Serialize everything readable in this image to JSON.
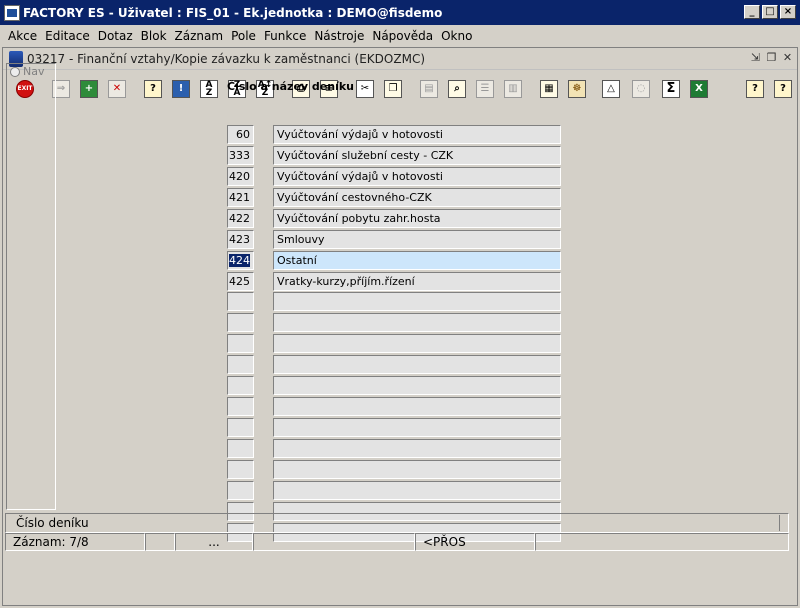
{
  "window": {
    "title": "FACTORY ES - Uživatel : FIS_01 - Ek.jednotka : DEMO@fisdemo"
  },
  "menu": [
    "Akce",
    "Editace",
    "Dotaz",
    "Blok",
    "Záznam",
    "Pole",
    "Funkce",
    "Nástroje",
    "Nápověda",
    "Okno"
  ],
  "form": {
    "title": "03217 - Finanční vztahy/Kopie závazku k zaměstnanci (EKDOZMC)"
  },
  "nav": {
    "label": "Nav"
  },
  "grid": {
    "header": "Číslo a název deníku",
    "rows": [
      {
        "num": "60",
        "name": "Vyúčtování výdajů v hotovosti"
      },
      {
        "num": "333",
        "name": "Vyúčtování služební cesty - CZK"
      },
      {
        "num": "420",
        "name": "Vyúčtování výdajů v hotovosti"
      },
      {
        "num": "421",
        "name": "Vyúčtování cestovného-CZK"
      },
      {
        "num": "422",
        "name": "Vyúčtování pobytu zahr.hosta"
      },
      {
        "num": "423",
        "name": "Smlouvy"
      },
      {
        "num": "424",
        "name": "Ostatní"
      },
      {
        "num": "425",
        "name": "Vratky-kurzy,příjím.řízení"
      },
      {
        "num": "",
        "name": ""
      },
      {
        "num": "",
        "name": ""
      },
      {
        "num": "",
        "name": ""
      },
      {
        "num": "",
        "name": ""
      },
      {
        "num": "",
        "name": ""
      },
      {
        "num": "",
        "name": ""
      },
      {
        "num": "",
        "name": ""
      },
      {
        "num": "",
        "name": ""
      },
      {
        "num": "",
        "name": ""
      },
      {
        "num": "",
        "name": ""
      },
      {
        "num": "",
        "name": ""
      },
      {
        "num": "",
        "name": ""
      }
    ],
    "current_row": 6
  },
  "status": {
    "hint": "Číslo deníku",
    "record": "Záznam: 7/8",
    "dots": "...",
    "mode": "<PŘOS"
  }
}
